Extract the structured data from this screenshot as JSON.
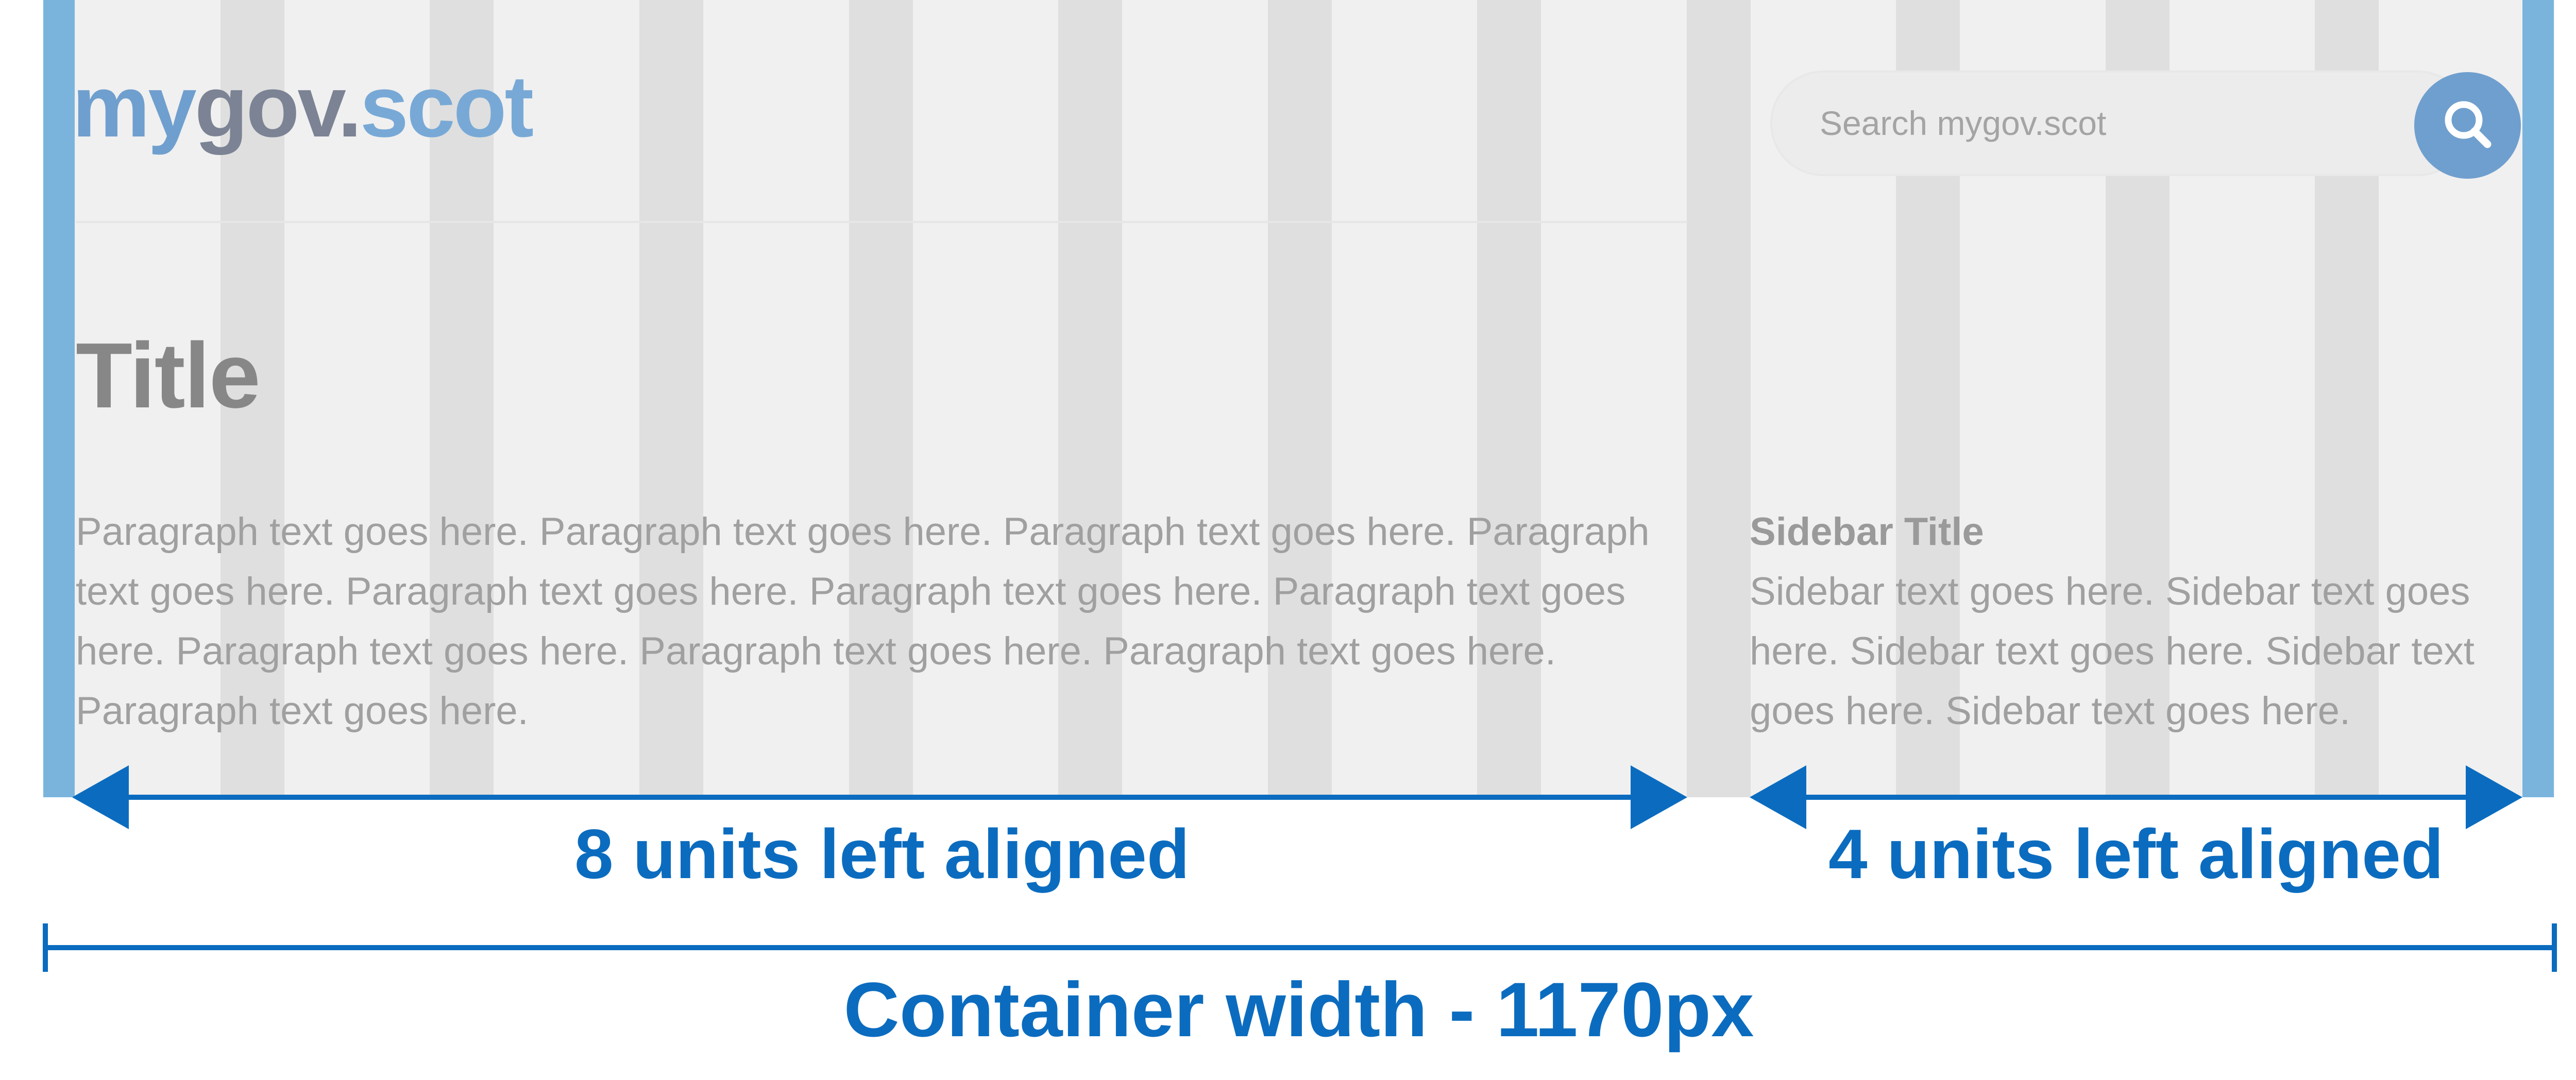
{
  "colors": {
    "annotation": "#0b6cbf",
    "container_edge": "#7ab4dd",
    "grid_column": "#dfdfdf",
    "page_background": "#f0f0f0",
    "logo_my": "#6f9fce",
    "logo_gov": "#7b8394",
    "logo_dot": "#7b8394",
    "logo_scot": "#78a9d6",
    "search_button": "#6f9fce"
  },
  "header": {
    "logo": {
      "my": "my",
      "gov": "gov",
      "dot": ".",
      "scot": "scot"
    },
    "search": {
      "placeholder": "Search mygov.scot",
      "icon": "magnifier-icon"
    }
  },
  "main": {
    "title": "Title",
    "paragraph": "Paragraph text goes here. Paragraph text goes here. Paragraph text goes here. Paragraph text goes here. Paragraph text goes here. Paragraph text goes here. Paragraph text goes here. Paragraph text goes here. Paragraph text goes here. Paragraph text goes here. Paragraph text goes here."
  },
  "sidebar": {
    "title": "Sidebar Title",
    "text": "Sidebar text goes here. Sidebar text goes here. Sidebar text goes here. Sidebar text goes here. Sidebar text goes here."
  },
  "annotations": {
    "main_column": "8 units left aligned",
    "sidebar_column": "4 units left aligned",
    "container": "Container width - 1170px"
  }
}
